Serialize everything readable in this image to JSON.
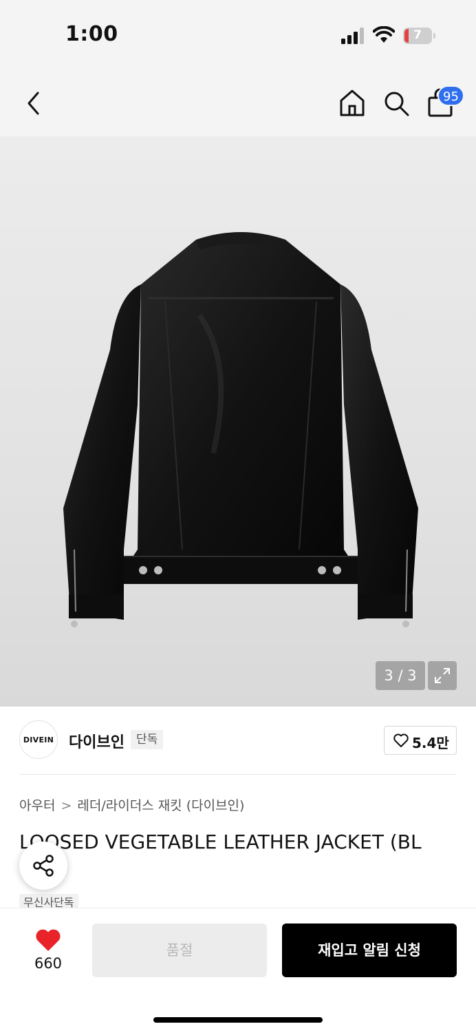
{
  "status_bar": {
    "time": "1:00",
    "battery_level": "7",
    "icons": [
      "signal-icon",
      "wifi-icon",
      "battery-icon"
    ]
  },
  "nav": {
    "icons": [
      "back-icon",
      "home-icon",
      "search-icon",
      "shopping-bag-icon"
    ],
    "cart_badge": "95",
    "badge_color": "#2f6fed"
  },
  "gallery": {
    "counter": "3 / 3",
    "image_subject": "black leather jacket, back view",
    "expand_icon": "expand-icon"
  },
  "brand": {
    "logo_text": "DIVEIN",
    "name": "다이브인",
    "tag": "단독",
    "like_count": "5.4만"
  },
  "breadcrumb": {
    "category": "아우터",
    "separator": ">",
    "subcategory": "레더/라이더스 재킷 (다이브인)"
  },
  "product": {
    "title": "LOOSED VEGETABLE LEATHER JACKET (BL",
    "exclusive_tag": "무신사단독"
  },
  "bottom_bar": {
    "wish_count": "660",
    "soldout_label": "품절",
    "restock_label": "재입고 알림 신청",
    "heart_color": "#e8232a"
  }
}
